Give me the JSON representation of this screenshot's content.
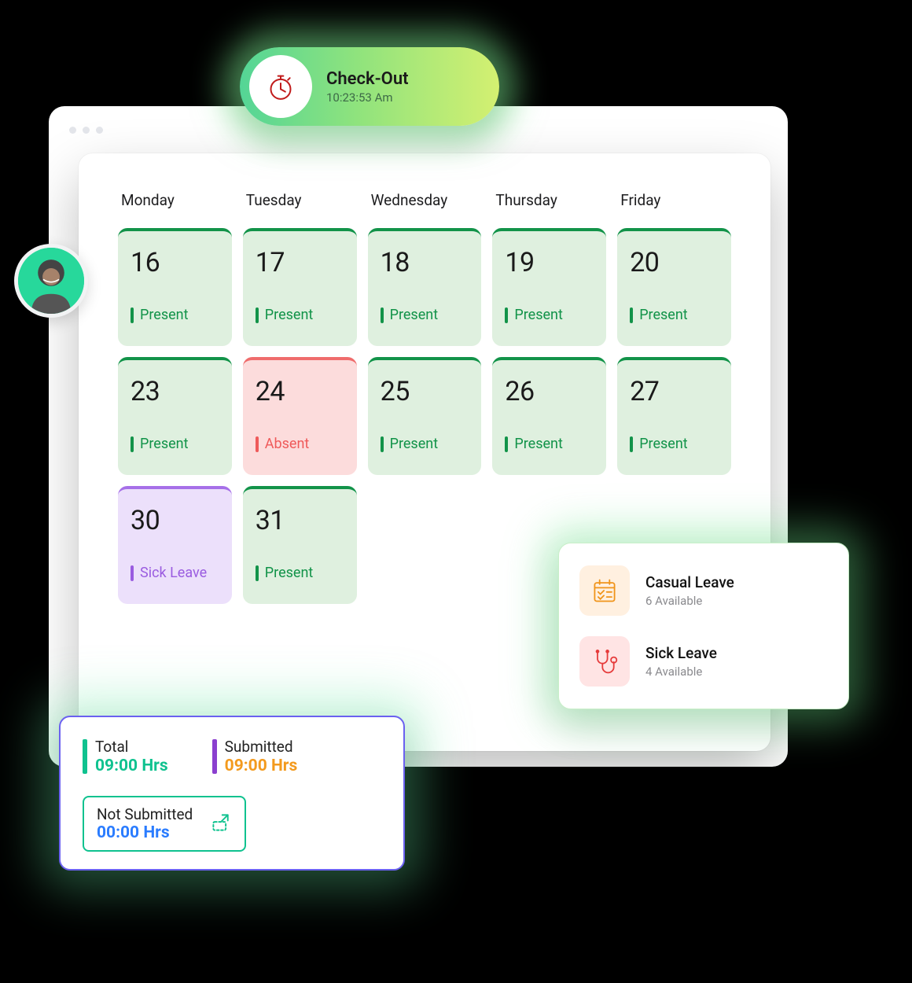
{
  "checkout": {
    "title": "Check-Out",
    "time": "10:23:53 Am"
  },
  "weekdays": [
    "Monday",
    "Tuesday",
    "Wednesday",
    "Thursday",
    "Friday"
  ],
  "days": [
    {
      "num": "16",
      "status": "Present",
      "kind": "present"
    },
    {
      "num": "17",
      "status": "Present",
      "kind": "present"
    },
    {
      "num": "18",
      "status": "Present",
      "kind": "present"
    },
    {
      "num": "19",
      "status": "Present",
      "kind": "present"
    },
    {
      "num": "20",
      "status": "Present",
      "kind": "present"
    },
    {
      "num": "23",
      "status": "Present",
      "kind": "present"
    },
    {
      "num": "24",
      "status": "Absent",
      "kind": "absent"
    },
    {
      "num": "25",
      "status": "Present",
      "kind": "present"
    },
    {
      "num": "26",
      "status": "Present",
      "kind": "present"
    },
    {
      "num": "27",
      "status": "Present",
      "kind": "present"
    },
    {
      "num": "30",
      "status": "Sick Leave",
      "kind": "sick"
    },
    {
      "num": "31",
      "status": "Present",
      "kind": "present"
    }
  ],
  "leave": {
    "casual": {
      "title": "Casual Leave",
      "sub": "6 Available"
    },
    "sick": {
      "title": "Sick Leave",
      "sub": "4 Available"
    }
  },
  "hours": {
    "total": {
      "label": "Total",
      "value": "09:00 Hrs"
    },
    "submitted": {
      "label": "Submitted",
      "value": "09:00 Hrs"
    },
    "notSubmitted": {
      "label": "Not Submitted",
      "value": "00:00 Hrs"
    }
  },
  "colors": {
    "present": "#129349",
    "absent": "#ef5a5a",
    "sick": "#9a5ce0"
  }
}
